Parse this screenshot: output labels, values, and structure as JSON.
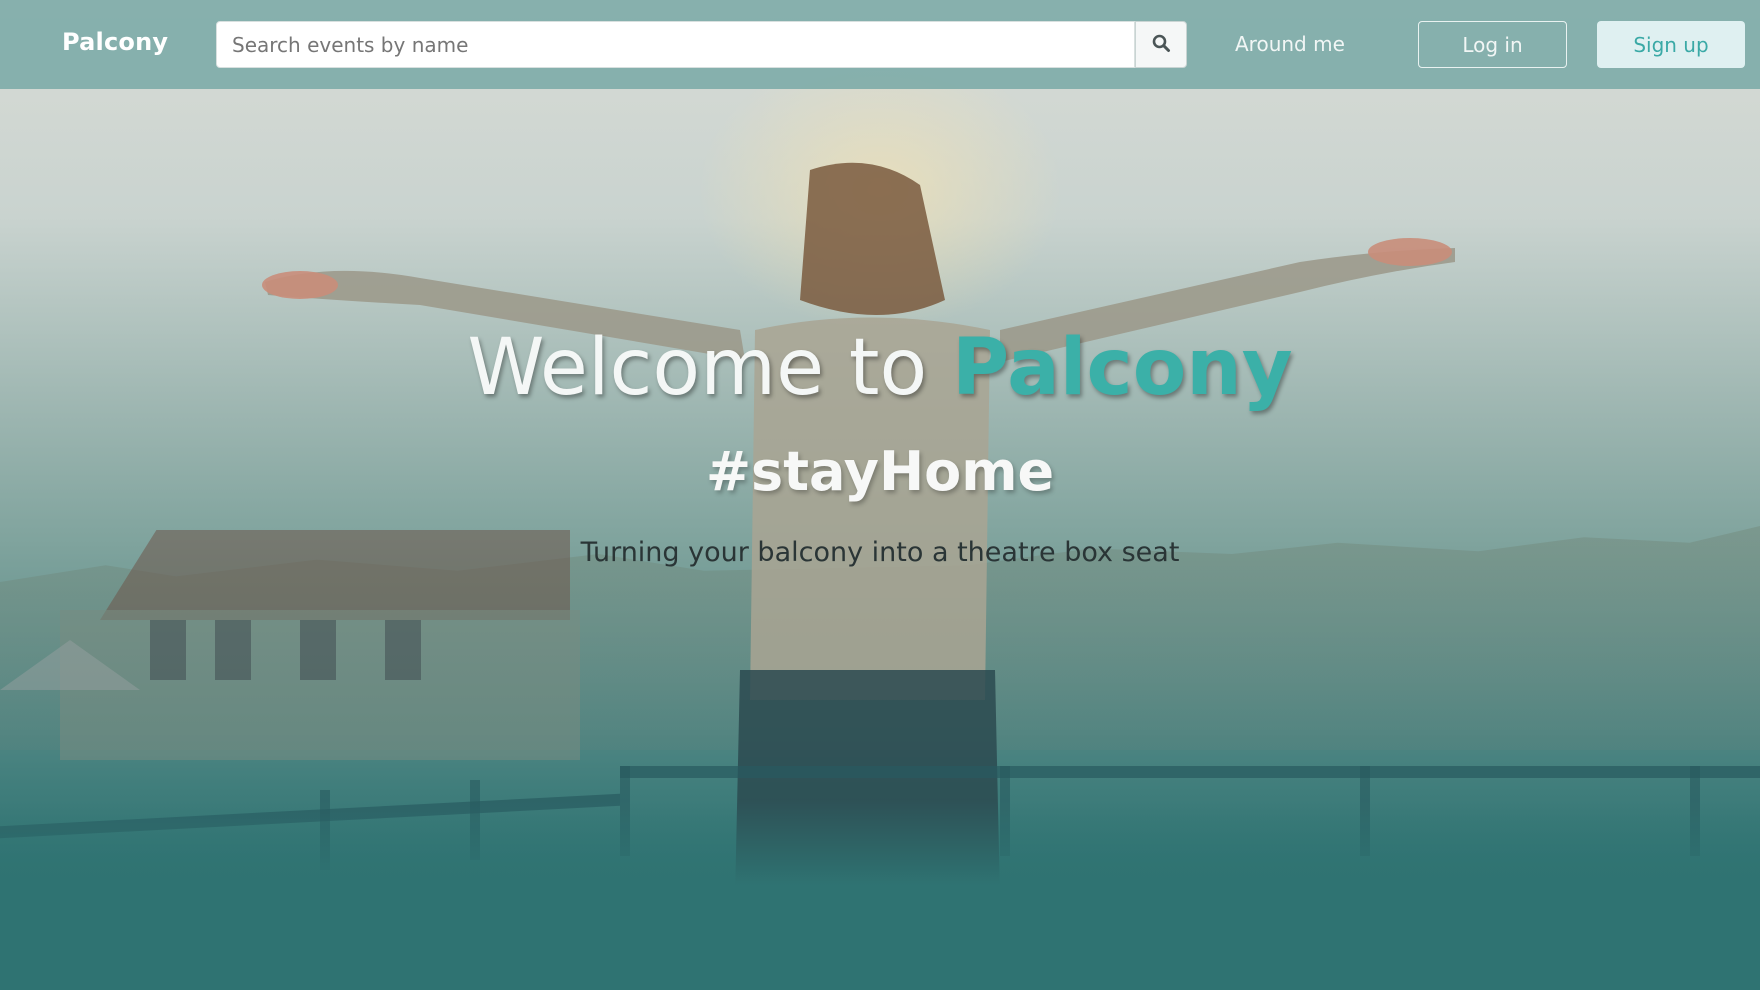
{
  "navbar": {
    "brand": "Palcony",
    "search": {
      "placeholder": "Search events by name",
      "value": ""
    },
    "search_button_icon": "search-icon",
    "around_me_label": "Around me",
    "login_label": "Log in",
    "signup_label": "Sign up"
  },
  "hero": {
    "title_prefix": "Welcome to",
    "title_accent": "Palcony",
    "hashtag": "#stayHome",
    "subtitle": "Turning your balcony into a theatre box seat"
  },
  "colors": {
    "accent": "#3bb0a8",
    "navbar": "#7baaa7",
    "background_bottom": "#2f7372",
    "signup_bg": "#dff0f1"
  }
}
